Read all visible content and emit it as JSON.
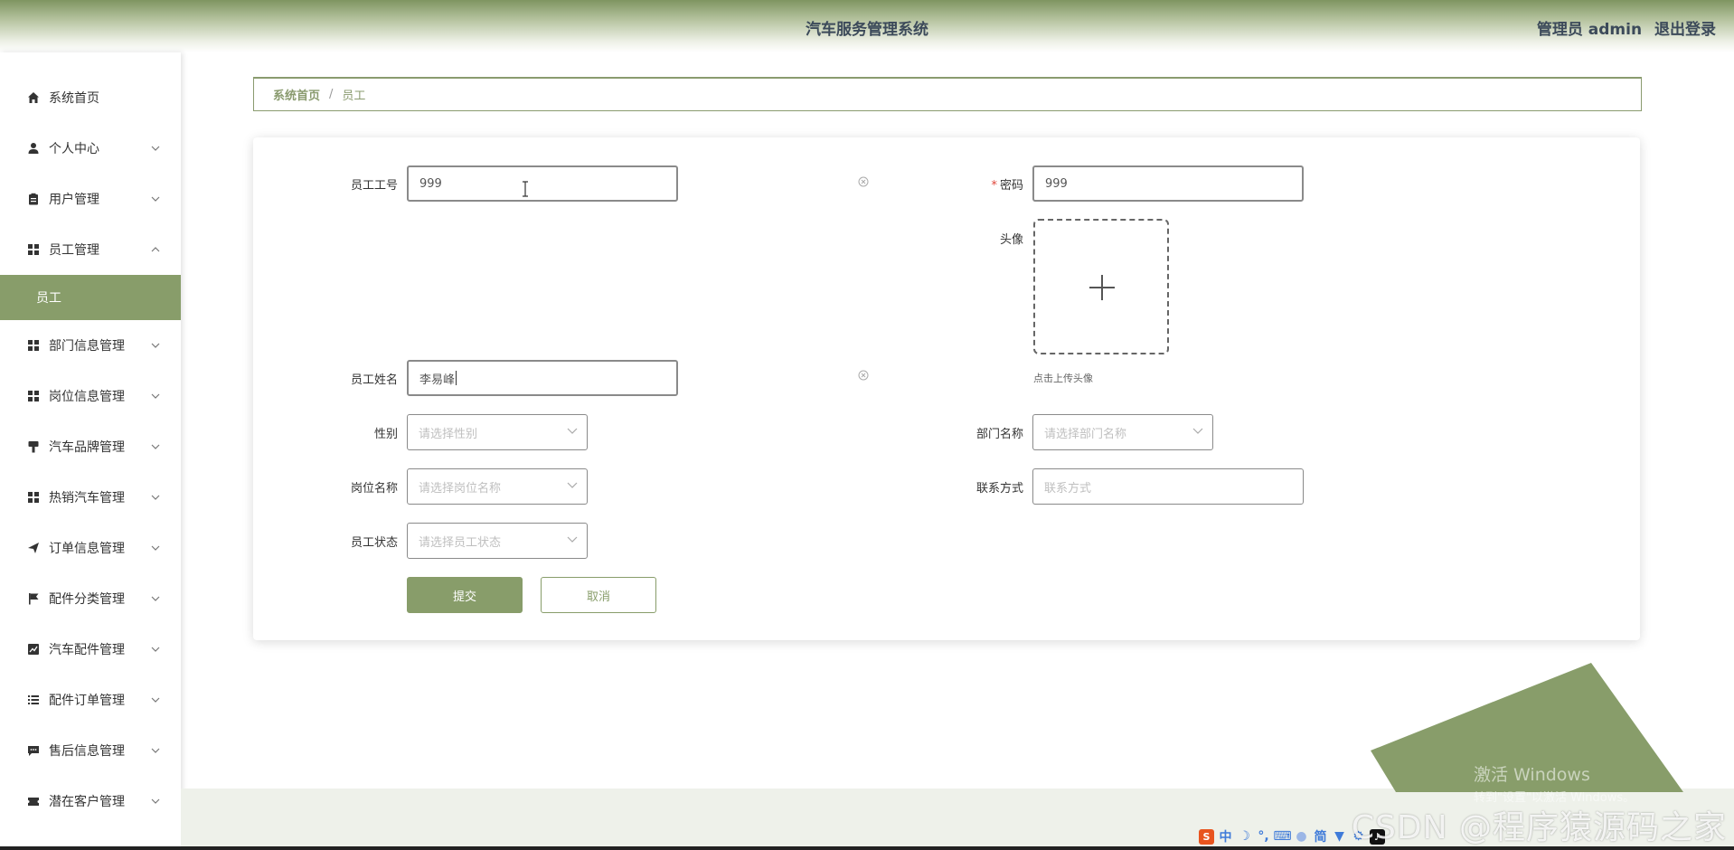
{
  "header": {
    "title": "汽车服务管理系统",
    "user": "管理员 admin",
    "logout": "退出登录"
  },
  "sidebar": {
    "items": [
      {
        "label": "系统首页",
        "icon": "home-icon"
      },
      {
        "label": "个人中心",
        "icon": "user-icon"
      },
      {
        "label": "用户管理",
        "icon": "clipboard-icon"
      },
      {
        "label": "员工管理",
        "icon": "grid-icon",
        "expanded": true
      },
      {
        "label": "员工",
        "sub": true,
        "active": true
      },
      {
        "label": "部门信息管理",
        "icon": "grid-icon"
      },
      {
        "label": "岗位信息管理",
        "icon": "grid-icon"
      },
      {
        "label": "汽车品牌管理",
        "icon": "brush-icon"
      },
      {
        "label": "热销汽车管理",
        "icon": "grid-icon"
      },
      {
        "label": "订单信息管理",
        "icon": "send-icon"
      },
      {
        "label": "配件分类管理",
        "icon": "flag-icon"
      },
      {
        "label": "汽车配件管理",
        "icon": "chart-icon"
      },
      {
        "label": "配件订单管理",
        "icon": "list-icon"
      },
      {
        "label": "售后信息管理",
        "icon": "message-icon"
      },
      {
        "label": "潜在客户管理",
        "icon": "ticket-icon"
      }
    ]
  },
  "breadcrumb": {
    "home": "系统首页",
    "separator": "/",
    "current": "员工"
  },
  "form": {
    "employee_no": {
      "label": "员工工号",
      "value": "999"
    },
    "password": {
      "label": "密码",
      "required_mark": "*",
      "value": "999"
    },
    "avatar": {
      "label": "头像",
      "hint": "点击上传头像"
    },
    "employee_name": {
      "label": "员工姓名",
      "value": "李易峰"
    },
    "gender": {
      "label": "性别",
      "placeholder": "请选择性别"
    },
    "department": {
      "label": "部门名称",
      "placeholder": "请选择部门名称"
    },
    "position": {
      "label": "岗位名称",
      "placeholder": "请选择岗位名称"
    },
    "contact": {
      "label": "联系方式",
      "placeholder": "联系方式"
    },
    "status": {
      "label": "员工状态",
      "placeholder": "请选择员工状态"
    },
    "submit": "提交",
    "cancel": "取消"
  },
  "overlay": {
    "win_title": "激活 Windows",
    "win_sub": "转到\"设置\"以激活 Windows。",
    "watermark": "CSDN @程序猿源码之家",
    "tray_lang": "中",
    "tray_simplified": "简"
  },
  "colors": {
    "accent": "#889d6a",
    "header": "#7f9561",
    "required": "#e0463b"
  }
}
